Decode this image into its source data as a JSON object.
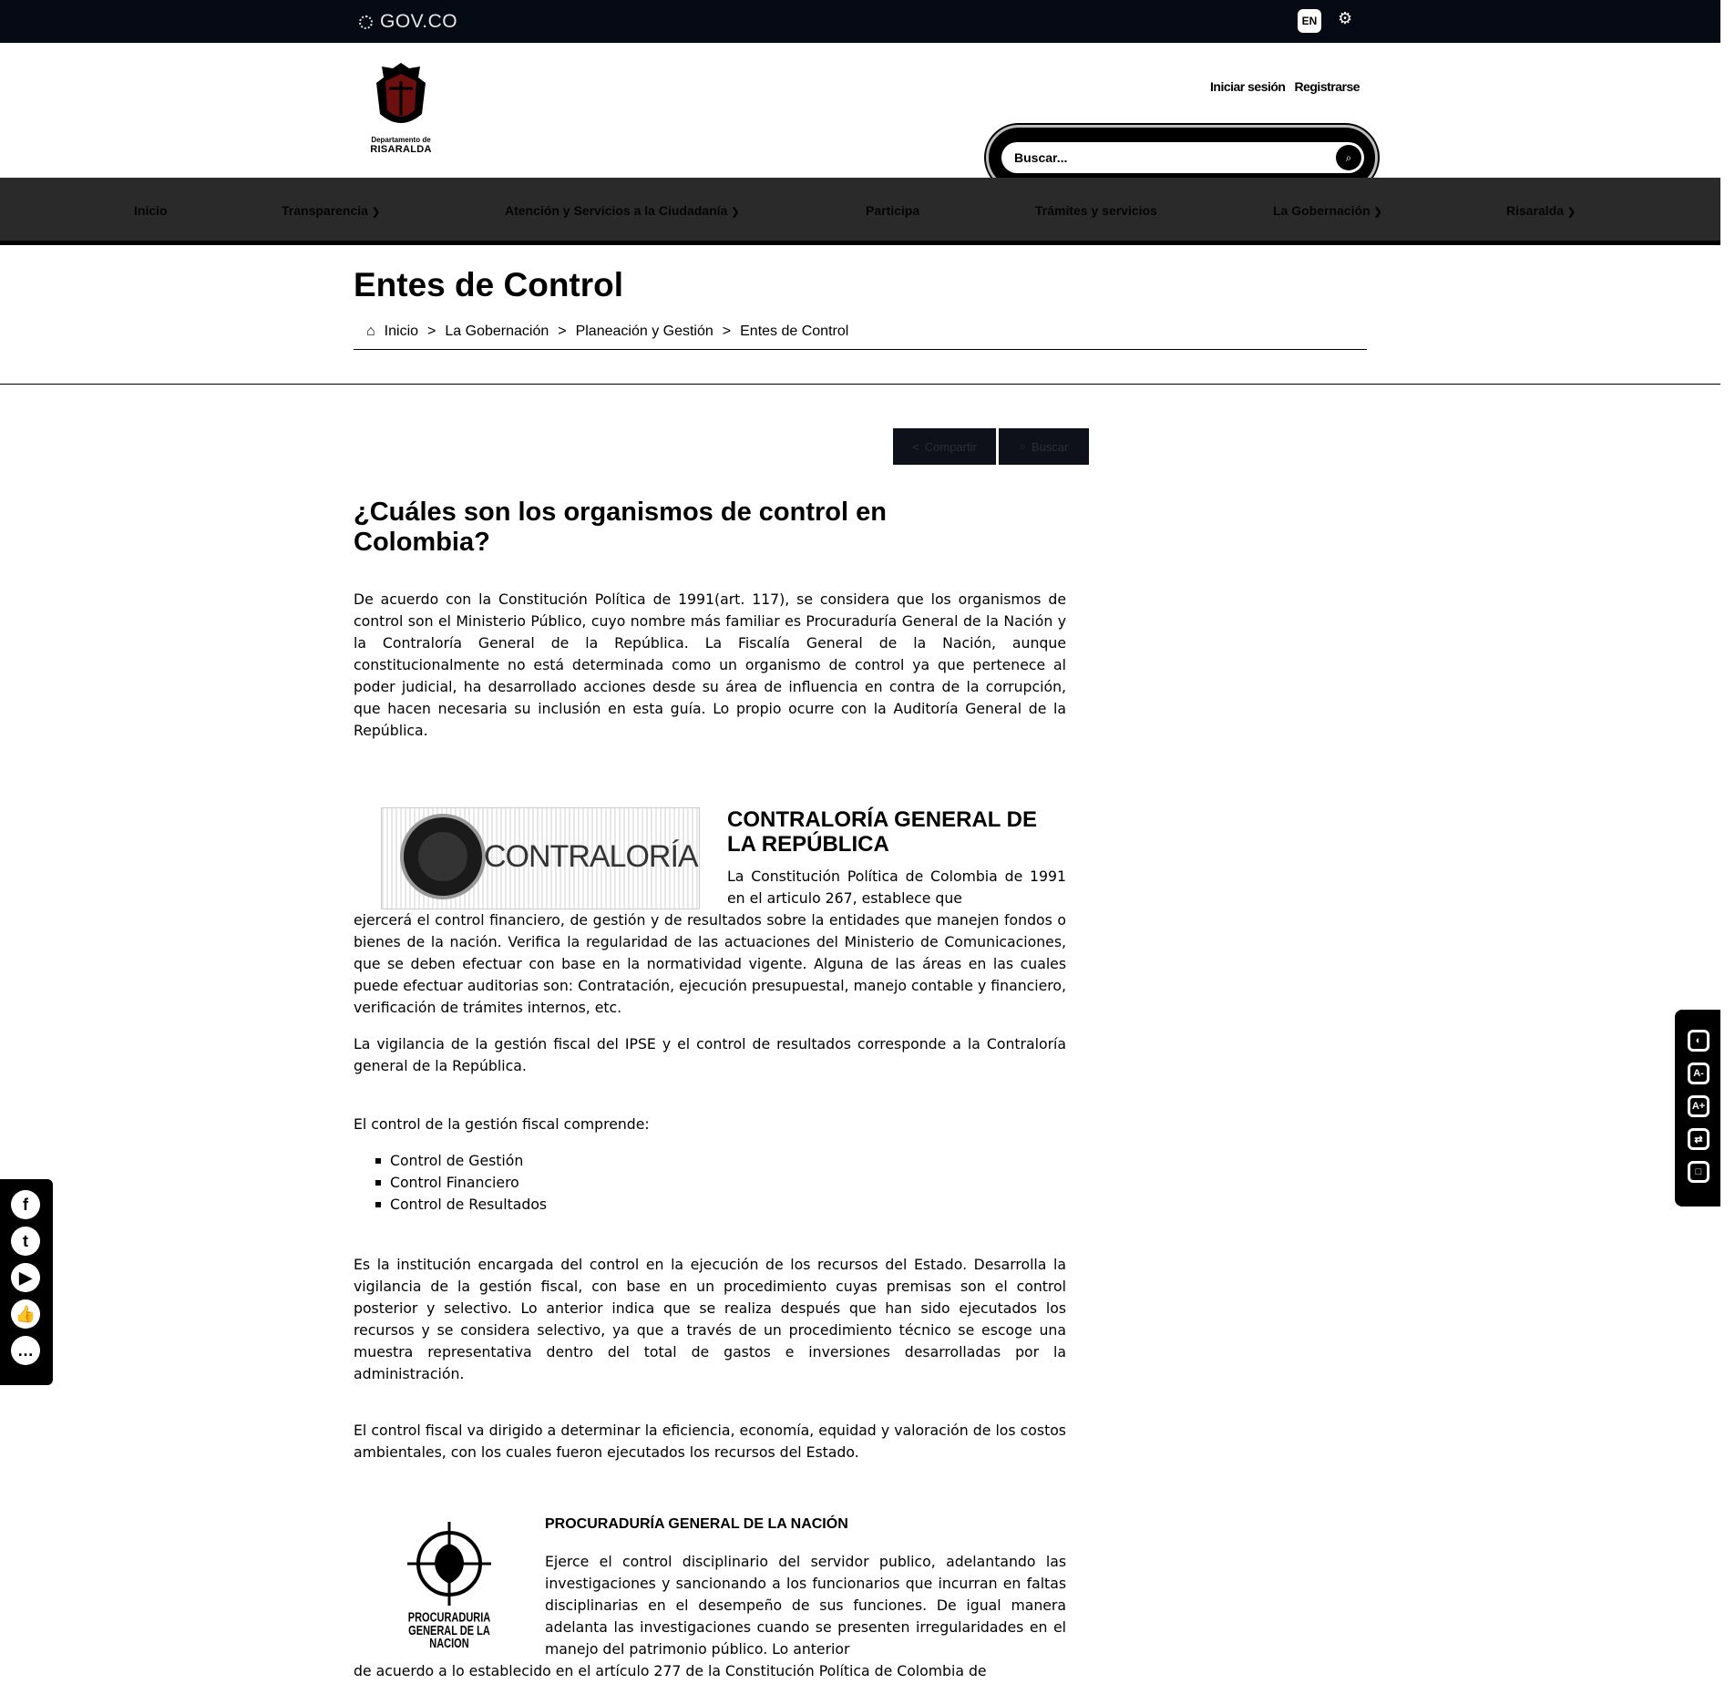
{
  "govbar": {
    "logo_text": "GOV.CO",
    "lang": "EN",
    "settings_icon": "gear-icon"
  },
  "header": {
    "logo_line1": "Departamento de",
    "logo_line2": "RISARALDA",
    "login": "Iniciar sesión",
    "register": "Registrarse",
    "search_placeholder": "Buscar..."
  },
  "nav": {
    "items": [
      {
        "label": "Inicio"
      },
      {
        "label": "Transparencia"
      },
      {
        "label": "Atención y Servicios a la Ciudadanía"
      },
      {
        "label": "Participa"
      },
      {
        "label": "Trámites y servicios"
      },
      {
        "label": "La Gobernación"
      },
      {
        "label": "Risaralda"
      }
    ]
  },
  "page": {
    "title": "Entes de Control",
    "breadcrumb": [
      "Inicio",
      "La Gobernación",
      "Planeación y Gestión",
      "Entes de Control"
    ],
    "share_label": "Compartir",
    "search_label": "Buscar"
  },
  "content": {
    "heading": "¿Cuáles son los organismos de control en Colombia?",
    "intro": "De acuerdo con la Constitución Política de 1991(art. 117), se considera que los organismos de control son el Ministerio Público, cuyo nombre más familiar es Procuraduría General de la Nación y la Contraloría General de la República. La Fiscalía General de la Nación, aunque constitucionalmente no está determinada como un organismo de control ya que pertenece al poder judicial, ha desarrollado acciones desde su área de influencia en contra de la corrupción, que hacen necesaria su inclusión en esta guía. Lo propio ocurre con la Auditoría General de la República.",
    "contraloria_logo_text": "CONTRALORÍA",
    "contraloria_title": "CONTRALORÍA GENERAL DE LA REPÚBLICA",
    "contraloria_p1a": "La Constitución Política de Colombia de 1991 en el articulo 267, establece que",
    "contraloria_p1b": "ejercerá el control financiero, de gestión y de resultados sobre la entidades que manejen fondos o bienes de la nación. Verifica la regularidad de las actuaciones del Ministerio de Comunicaciones, que se deben efectuar con base en la normatividad vigente. Alguna de las áreas en las cuales puede efectuar auditorias son: Contratación, ejecución presupuestal, manejo contable y financiero, verificación de trámites internos, etc.",
    "contraloria_p2": "La vigilancia de la gestión fiscal del IPSE y el control de resultados corresponde a la Contraloría general de la República.",
    "control_intro": "El control de la gestión fiscal comprende:",
    "control_list": [
      "Control de Gestión",
      "Control Financiero",
      "Control de Resultados"
    ],
    "contraloria_p3": "Es la institución encargada del control en la ejecución de los recursos del Estado. Desarrolla la vigilancia de la gestión fiscal, con base en un procedimiento cuyas premisas son el control posterior y selectivo. Lo anterior indica que se realiza después que han sido ejecutados los recursos y se considera selectivo, ya que a través de un procedimiento técnico se escoge una muestra representativa dentro del total de gastos e inversiones desarrolladas por la administración.",
    "contraloria_p4": "El control fiscal va dirigido a determinar la eficiencia, economía, equidad y valoración de los costos ambientales, con los cuales fueron ejecutados los recursos del Estado.",
    "procuraduria_logo_line1": "PROCURADURIA",
    "procuraduria_logo_line2": "GENERAL DE LA NACION",
    "procuraduria_title": "PROCURADURÍA GENERAL DE LA NACIÓN",
    "procuraduria_p1a": "Ejerce el control disciplinario del servidor publico, adelantando las investigaciones y sancionando a los funcionarios que incurran en faltas disciplinarias en el desempeño de sus funciones. De igual manera adelanta las investigaciones cuando se presenten irregularidades en el manejo del patrimonio público. Lo anterior",
    "procuraduria_p1b": "de acuerdo a lo establecido en el artículo 277 de la Constitución Política de Colombia de"
  },
  "social": [
    "facebook-icon",
    "twitter-icon",
    "youtube-icon",
    "like-icon",
    "chat-icon"
  ],
  "accessibility": [
    "contrast-icon",
    "font-decrease-icon",
    "font-increase-icon",
    "translate-icon",
    "reset-icon"
  ]
}
